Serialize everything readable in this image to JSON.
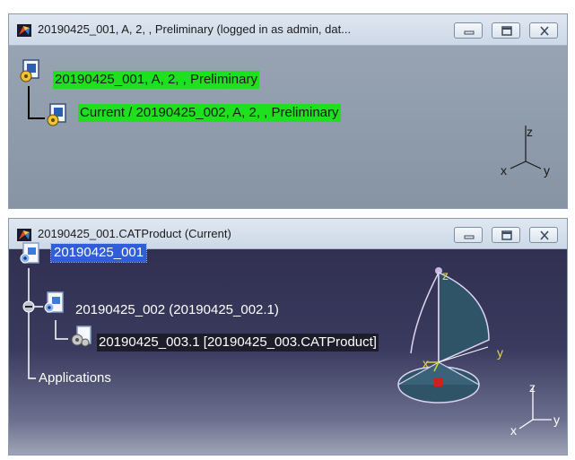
{
  "top_window": {
    "title": "20190425_001, A, 2, , Preliminary (logged in as admin, dat...",
    "tree": {
      "root_label": "20190425_001, A, 2, , Preliminary",
      "child_label": "Current / 20190425_002, A, 2, , Preliminary"
    },
    "axis": {
      "x": "x",
      "y": "y",
      "z": "z"
    }
  },
  "bottom_window": {
    "title": "20190425_001.CATProduct (Current)",
    "tree": {
      "root_label": "20190425_001",
      "child_label": "20190425_002 (20190425_002.1)",
      "grandchild_label": "20190425_003.1 [20190425_003.CATProduct]",
      "applications_label": "Applications"
    },
    "compass": {
      "z": "z",
      "y": "y",
      "x": "x"
    },
    "axis": {
      "x": "x",
      "y": "y",
      "z": "z"
    }
  },
  "colors": {
    "highlight_green": "#1fe01f",
    "selection_blue": "#2f5ed8",
    "viewport_dark": "#2e2d4e"
  },
  "icons": {
    "app": "catia-window-icon",
    "minimize": "minimize-icon",
    "maximize": "maximize-icon",
    "close": "close-icon",
    "product": "product-node-icon",
    "component": "component-node-icon",
    "applications": "applications-branch"
  }
}
